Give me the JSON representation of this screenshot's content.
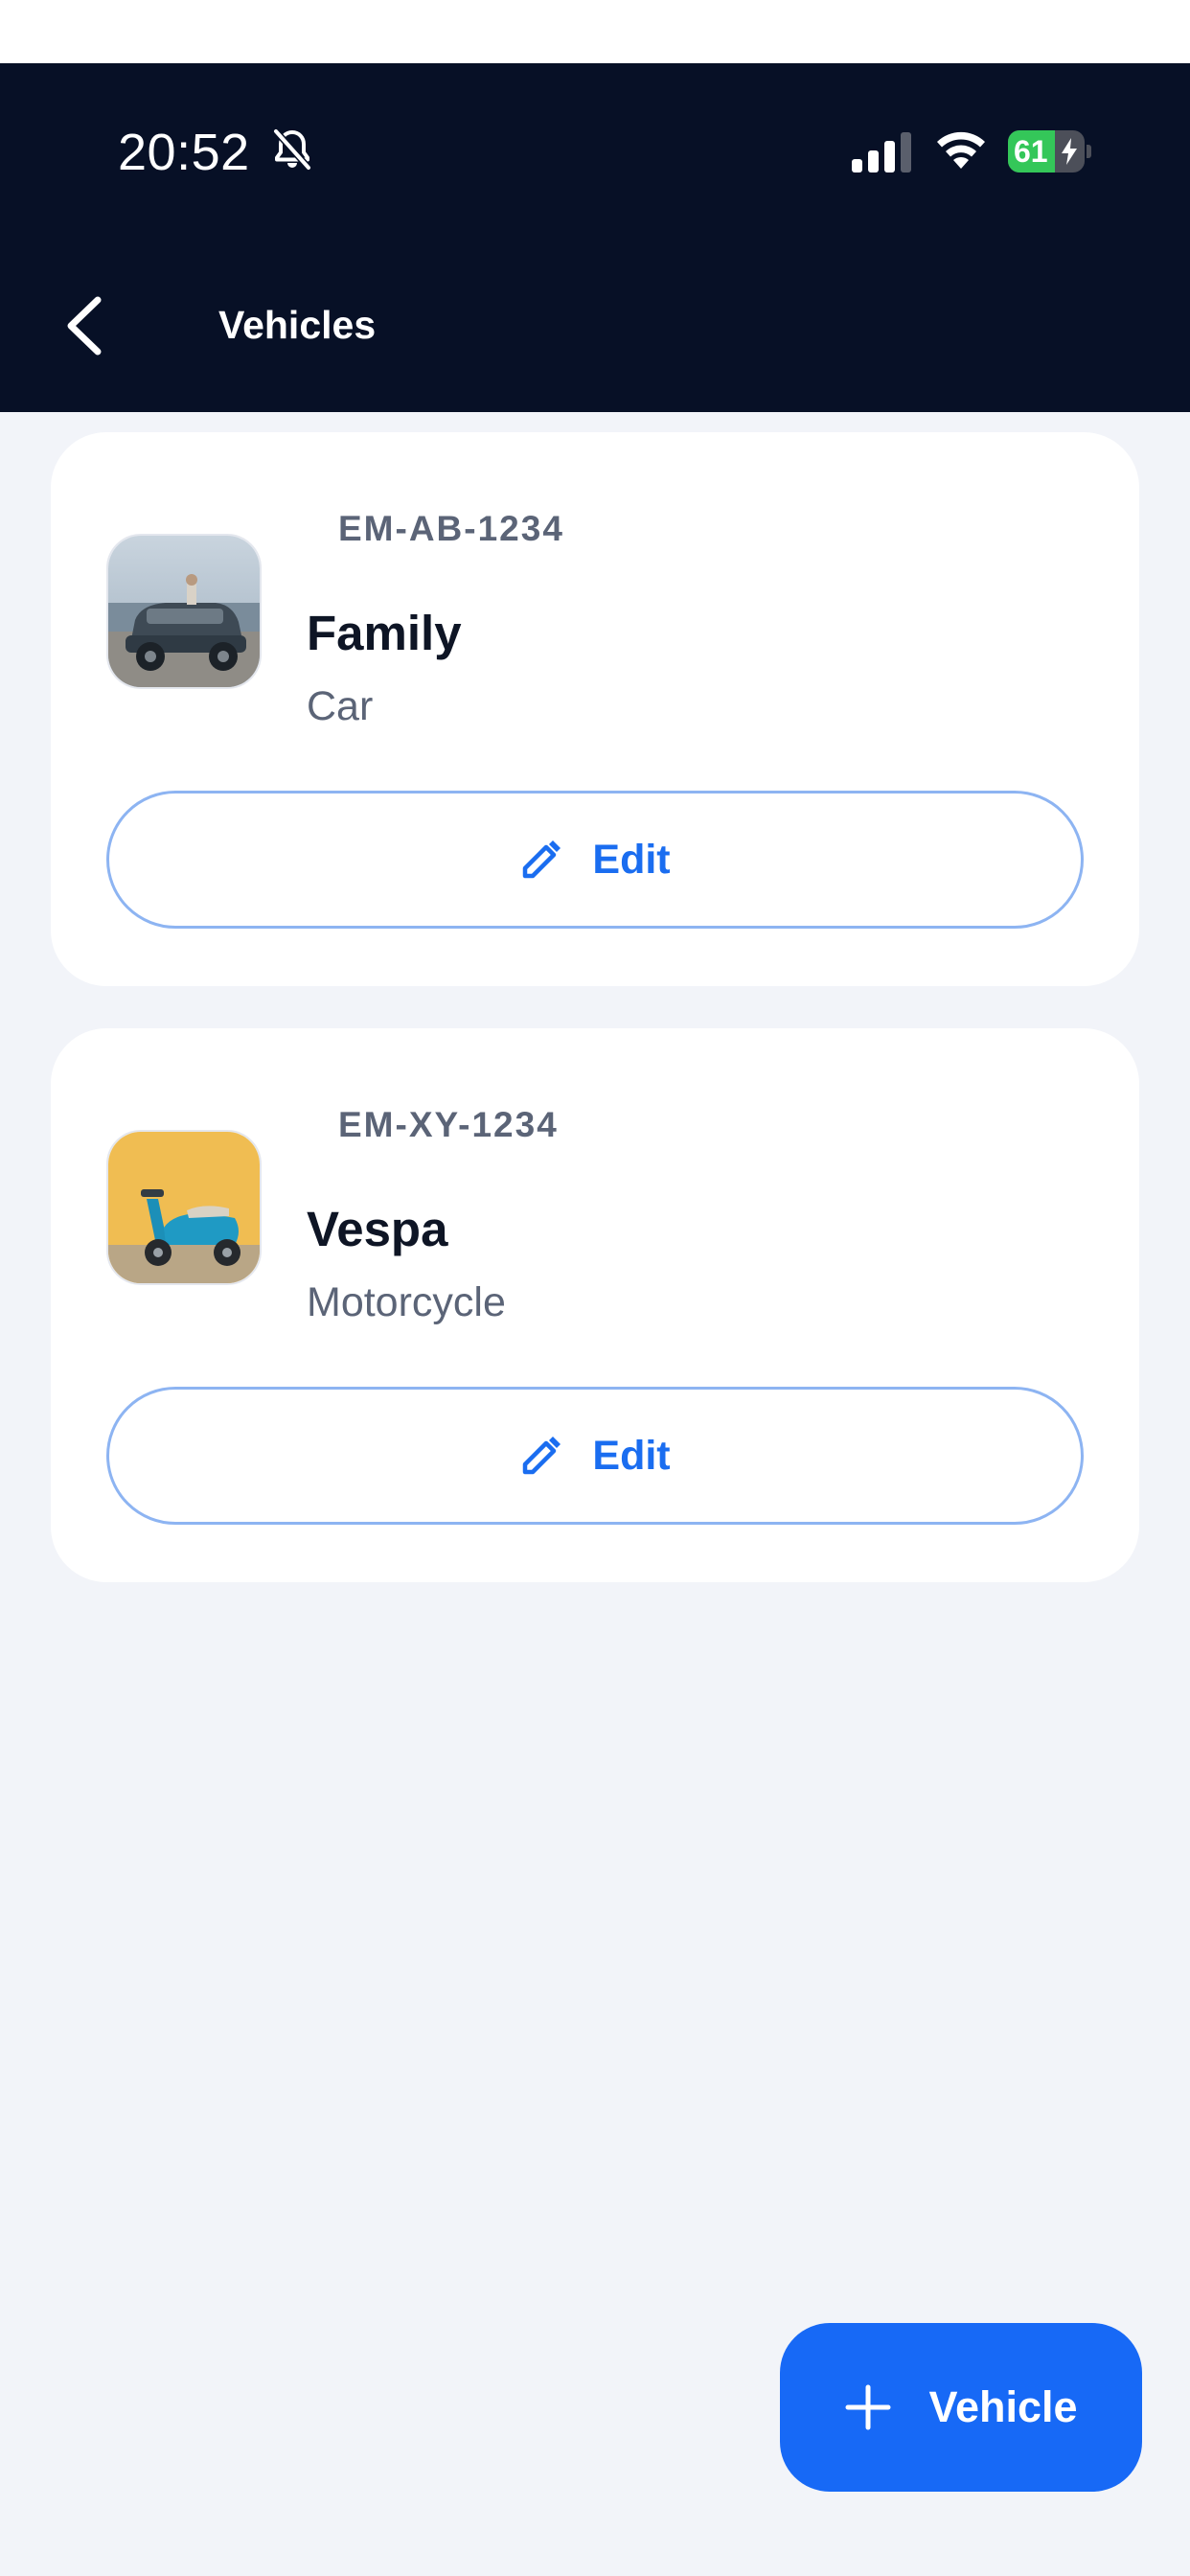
{
  "status_bar": {
    "time": "20:52",
    "battery_percent": "61",
    "battery_level": 0.61,
    "signal_bars": 3,
    "icons": [
      "bell-slash-icon",
      "cellular-signal-icon",
      "wifi-icon",
      "battery-charging-icon"
    ]
  },
  "header": {
    "title": "Vehicles",
    "back_icon": "chevron-left-icon"
  },
  "vehicles": [
    {
      "plate": "EM-AB-1234",
      "name": "Family",
      "type": "Car",
      "image": "car-photo",
      "edit_label": "Edit",
      "edit_icon": "pencil-icon"
    },
    {
      "plate": "EM-XY-1234",
      "name": "Vespa",
      "type": "Motorcycle",
      "image": "scooter-photo",
      "edit_label": "Edit",
      "edit_icon": "pencil-icon"
    }
  ],
  "fab": {
    "label": "Vehicle",
    "icon": "plus-icon"
  },
  "colors": {
    "header_bg": "#071026",
    "page_bg": "#f2f4f9",
    "accent": "#1769f6",
    "edit_text": "#1a6df0",
    "edit_border": "#8db4f2",
    "battery_green": "#34c759"
  }
}
